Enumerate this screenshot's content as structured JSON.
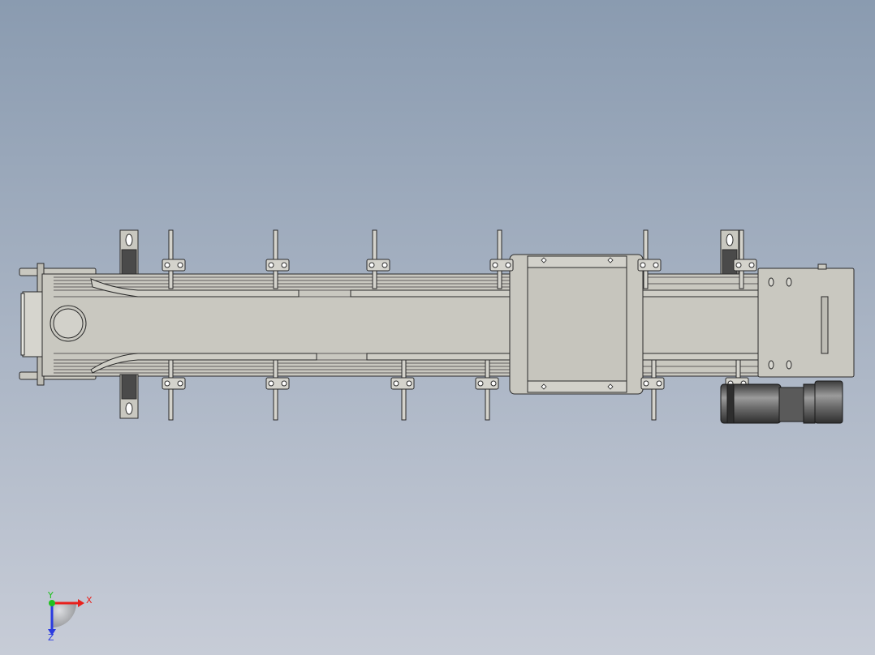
{
  "viewport": {
    "background_top": "#8a9bb0",
    "background_bottom": "#c6cbd6"
  },
  "triad": {
    "x_label": "X",
    "y_label": "Y",
    "z_label": "Z",
    "x_color": "#e8201c",
    "y_color": "#1fc11f",
    "z_color": "#2a3be0"
  },
  "model": {
    "name_icon": "conveyor-assembly-icon",
    "body_color": "#c9c8c0",
    "edge_color": "#2a2a2a",
    "dark_part_color": "#4a4a4a"
  }
}
